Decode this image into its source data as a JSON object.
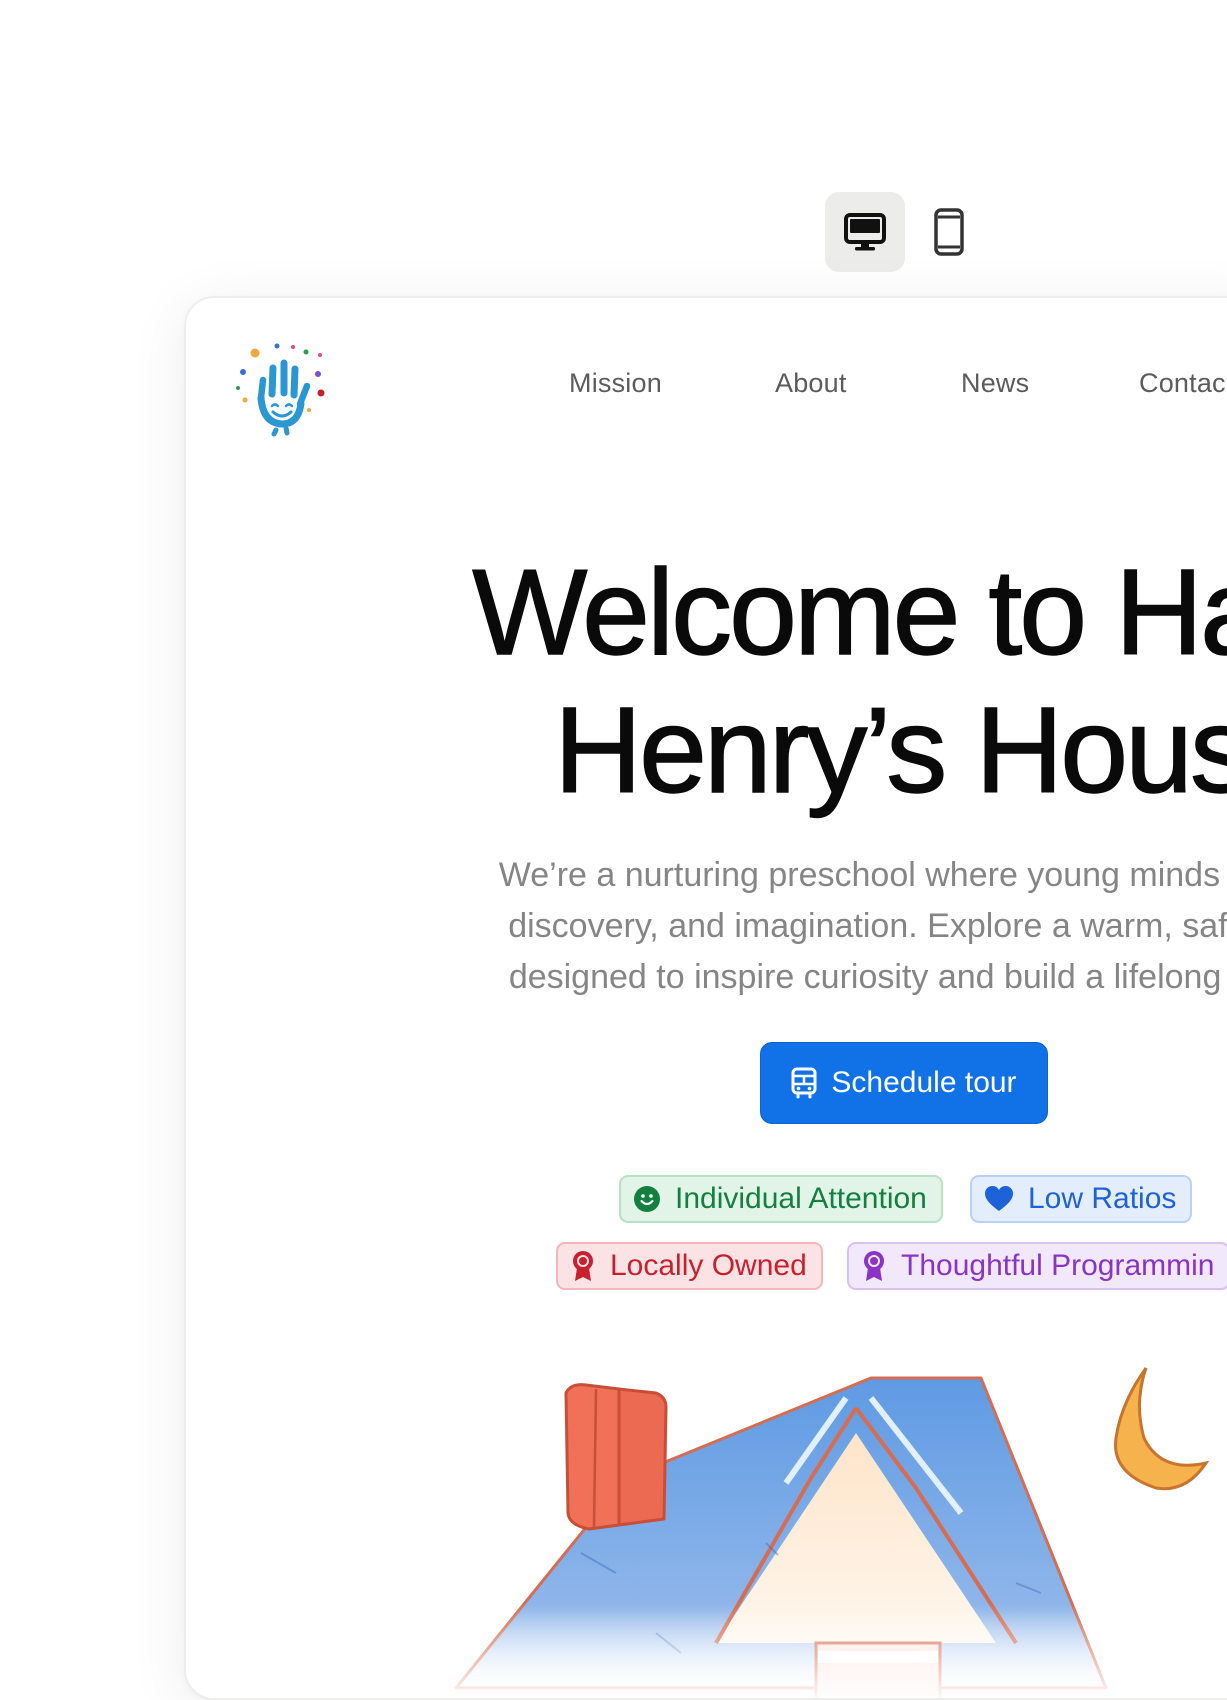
{
  "view_toggle": {
    "desktop_icon": "monitor-icon",
    "mobile_icon": "phone-icon",
    "active": "desktop"
  },
  "site": {
    "logo_icon": "hand-smile-logo",
    "nav": [
      "Mission",
      "About",
      "News",
      "Contac"
    ],
    "hero": {
      "title_lines": [
        "Welcome to Hap",
        "Henry’s Hous"
      ],
      "subtitle_lines": [
        "We’re a nurturing preschool where young minds grow",
        "discovery, and imagination. Explore a warm, safe en",
        "designed to inspire curiosity and build a lifelong love"
      ],
      "cta_label": "Schedule tour",
      "cta_icon": "bus-icon"
    },
    "badges": [
      {
        "label": "Individual Attention",
        "icon": "smile-icon",
        "color": "#13803f"
      },
      {
        "label": "Low Ratios",
        "icon": "heart-icon",
        "color": "#1d62d8"
      },
      {
        "label": "Locally Owned",
        "icon": "award-ribbon-icon",
        "color": "#c8202d"
      },
      {
        "label": "Thoughtful Programmin",
        "icon": "award-ribbon-icon",
        "color": "#8a33c7"
      }
    ],
    "illustration": "house-with-moon-illustration"
  },
  "colors": {
    "accent": "#1171e6",
    "title_text": "#0a0a0a",
    "subtitle_text": "#858585",
    "nav_text": "#5b5b5b"
  }
}
